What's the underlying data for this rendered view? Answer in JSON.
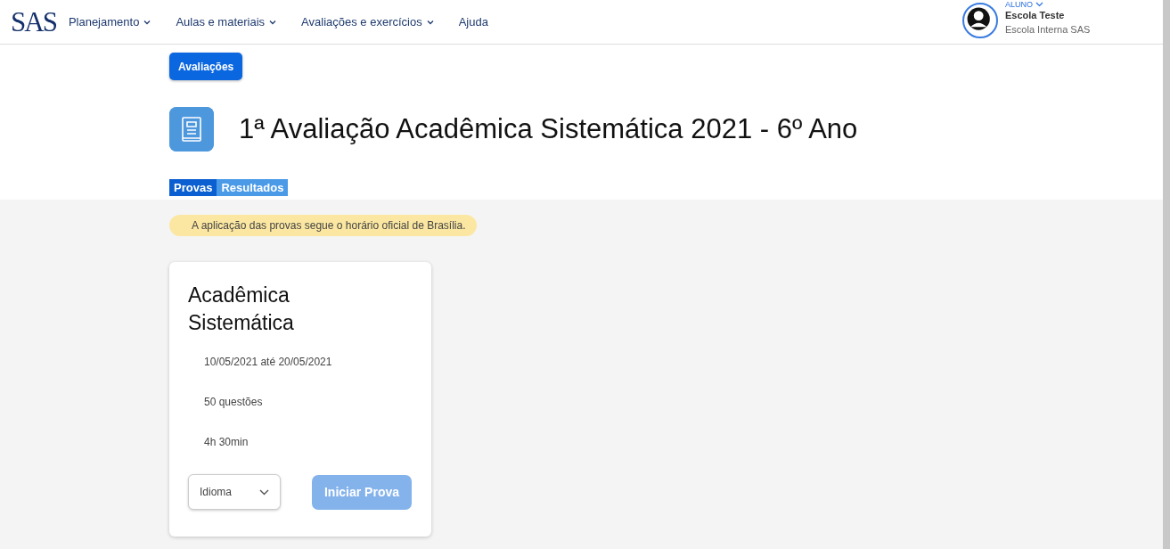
{
  "header": {
    "logo": "SAS",
    "nav": [
      {
        "label": "Planejamento",
        "has_menu": true
      },
      {
        "label": "Aulas e materiais",
        "has_menu": true
      },
      {
        "label": "Avaliações e exercícios",
        "has_menu": true
      },
      {
        "label": "Ajuda",
        "has_menu": false
      }
    ],
    "user": {
      "role": "ALUNO",
      "name": "Escola Teste",
      "school": "Escola Interna SAS"
    }
  },
  "breadcrumb": "Avaliações",
  "title": "1ª Avaliação Acadêmica Sistemática 2021 - 6º Ano",
  "tabs": [
    {
      "label": "Provas",
      "selected": true
    },
    {
      "label": "Resultados",
      "selected": false
    }
  ],
  "notice": "A aplicação das provas segue o horário oficial de Brasília.",
  "exams": [
    {
      "title": "Acadêmica Sistemática",
      "period": "10/05/2021 até 20/05/2021",
      "questions": "50 questões",
      "duration": "4h 30min",
      "language": {
        "placeholder": "Idioma"
      },
      "start": {
        "label": "Iniciar Prova",
        "disabled": true
      }
    }
  ]
}
